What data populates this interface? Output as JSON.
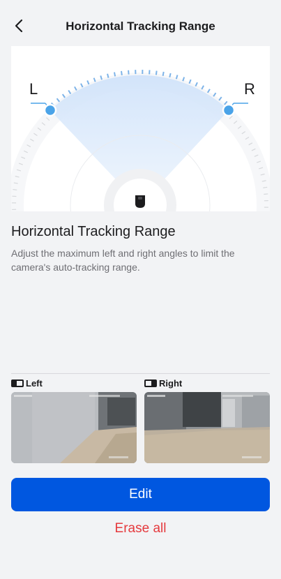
{
  "header": {
    "title": "Horizontal Tracking Range",
    "back_icon": "chevron-left-icon"
  },
  "dial": {
    "left_label": "L",
    "right_label": "R",
    "handle_color": "#4aa3e8",
    "sector_color": "#dbe8f9",
    "tick_color": "#7db3e8"
  },
  "section": {
    "title": "Horizontal Tracking Range",
    "description": "Adjust the maximum left and right angles to limit the camera's auto-tracking range."
  },
  "previews": [
    {
      "label": "Left",
      "icon": "left-half-frame-icon"
    },
    {
      "label": "Right",
      "icon": "right-half-frame-icon"
    }
  ],
  "actions": {
    "edit_label": "Edit",
    "erase_label": "Erase all",
    "primary_color": "#0057e0",
    "danger_color": "#e5393d"
  }
}
